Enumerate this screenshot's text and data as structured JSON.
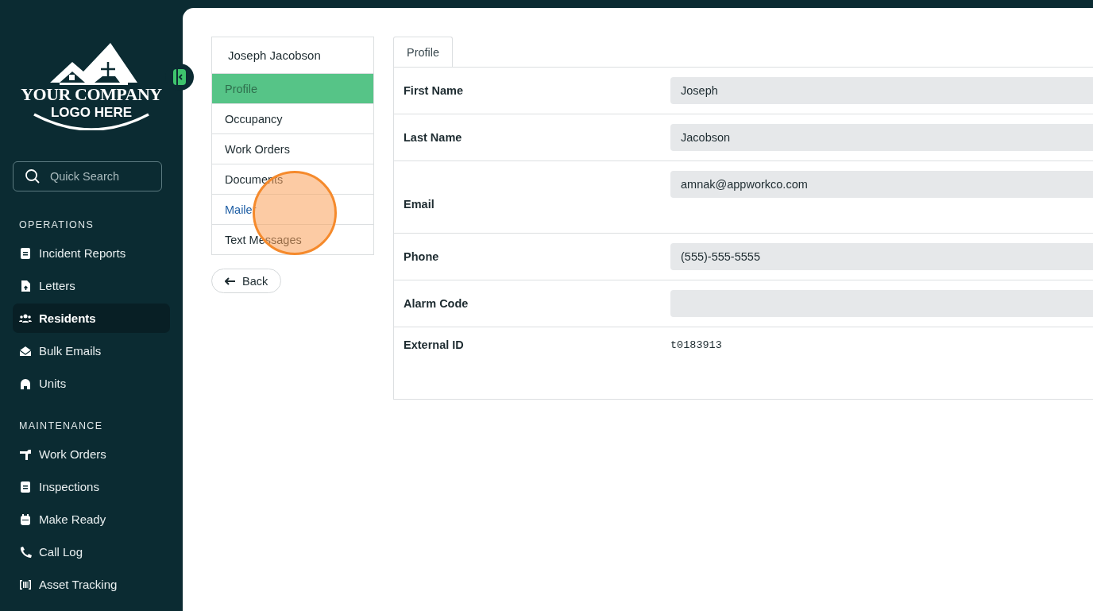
{
  "sidebar": {
    "logo": {
      "line1": "YOUR COMPANY",
      "line2": "LOGO HERE"
    },
    "search": {
      "placeholder": "Quick Search"
    },
    "sections": [
      {
        "title": "OPERATIONS",
        "items": [
          {
            "label": "Incident Reports",
            "selected": false
          },
          {
            "label": "Letters",
            "selected": false
          },
          {
            "label": "Residents",
            "selected": true
          },
          {
            "label": "Bulk Emails",
            "selected": false
          },
          {
            "label": "Units",
            "selected": false
          }
        ]
      },
      {
        "title": "MAINTENANCE",
        "items": [
          {
            "label": "Work Orders",
            "selected": false
          },
          {
            "label": "Inspections",
            "selected": false
          },
          {
            "label": "Make Ready",
            "selected": false
          },
          {
            "label": "Call Log",
            "selected": false
          },
          {
            "label": "Asset Tracking",
            "selected": false
          }
        ]
      }
    ]
  },
  "resident_nav": {
    "name": "Joseph Jacobson",
    "items": [
      {
        "label": "Profile",
        "selected": true,
        "hovered": false
      },
      {
        "label": "Occupancy",
        "selected": false,
        "hovered": false
      },
      {
        "label": "Work Orders",
        "selected": false,
        "hovered": false
      },
      {
        "label": "Documents",
        "selected": false,
        "hovered": false
      },
      {
        "label": "Mailer",
        "selected": false,
        "hovered": true
      },
      {
        "label": "Text Messages",
        "selected": false,
        "hovered": false
      }
    ],
    "back": "Back"
  },
  "tabs": [
    {
      "label": "Profile",
      "selected": true
    }
  ],
  "fields": [
    {
      "label": "First Name",
      "kind": "input",
      "value": "Joseph"
    },
    {
      "label": "Last Name",
      "kind": "input",
      "value": "Jacobson"
    },
    {
      "label": "Email",
      "kind": "input-tall",
      "value": "amnak@appworkco.com"
    },
    {
      "label": "Phone",
      "kind": "input",
      "value": "(555)-555-5555"
    },
    {
      "label": "Alarm Code",
      "kind": "input"
    },
    {
      "label": "External ID",
      "kind": "text",
      "value": "t0183913"
    }
  ]
}
